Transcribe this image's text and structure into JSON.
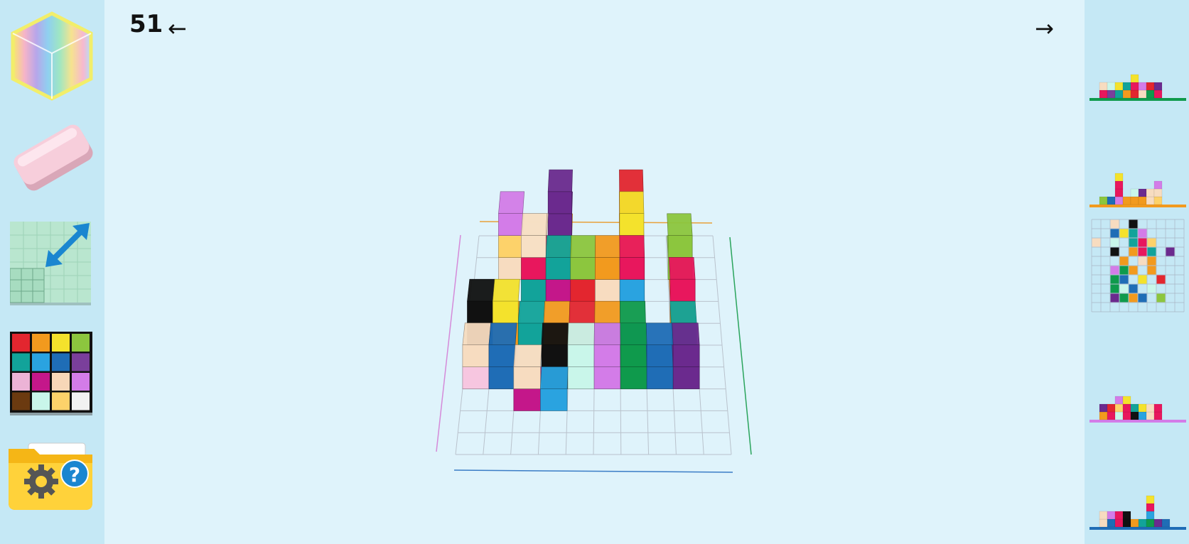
{
  "header": {
    "level_number": "51",
    "prev_symbol": "←",
    "next_symbol": "→"
  },
  "sidebar": {
    "tools": [
      {
        "name": "rainbow-cube-tool",
        "icon": "rainbow-cube-icon"
      },
      {
        "name": "eraser-tool",
        "icon": "eraser-icon"
      },
      {
        "name": "grid-resize-tool",
        "icon": "grid-resize-icon"
      },
      {
        "name": "color-palette-tool",
        "icon": "color-palette-icon"
      },
      {
        "name": "settings-help-folder",
        "icon": "folder-gear-help-icon"
      }
    ],
    "palette_colors": [
      "#e3262f",
      "#f29a1e",
      "#f4e22c",
      "#8cc63e",
      "#12a39a",
      "#2aa3e0",
      "#1f6db6",
      "#7a3f9b",
      "#ecb3d6",
      "#c4178a",
      "#f7d7b8",
      "#d37ce8",
      "#6b3a10",
      "#c9f6ea",
      "#fdd26a",
      "#f2f2f2"
    ]
  },
  "colors": {
    "background": "#dff3fb",
    "sidebar": "#c5e8f5",
    "grid_line": "#b9c2cc",
    "axis_top": "#e8a13a",
    "axis_left": "#d58ad9",
    "axis_right": "#2aa45c",
    "axis_bottom": "#3a7cc6"
  }
}
